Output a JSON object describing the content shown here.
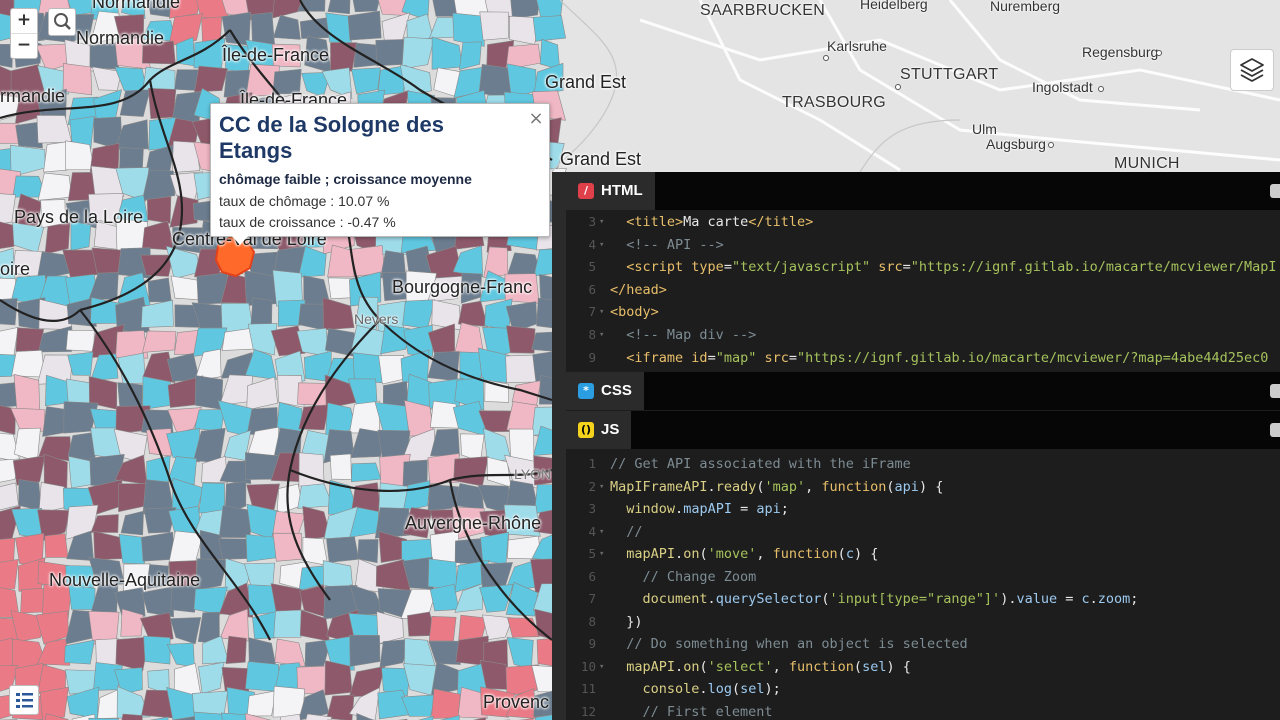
{
  "map": {
    "zoom_in": "+",
    "zoom_out": "−",
    "regions": [
      {
        "name": "Normandie",
        "id": "normandie-top"
      },
      {
        "name": "Normandie",
        "id": "normandie"
      },
      {
        "name": "rmandie",
        "id": "normandie-left"
      },
      {
        "name": "Île-de-France",
        "id": "idf"
      },
      {
        "name": "Île-de-France",
        "id": "idf2"
      },
      {
        "name": "Grand Est",
        "id": "grandest"
      },
      {
        "name": "Grand Est",
        "id": "grandest2"
      },
      {
        "name": "Pays de la Loire",
        "id": "pdl"
      },
      {
        "name": "oire",
        "id": "loire-left"
      },
      {
        "name": "Centre-Val de Loire",
        "id": "cvl"
      },
      {
        "name": "Bourgogne-Franc",
        "id": "bfc"
      },
      {
        "name": "Auvergne-Rhône",
        "id": "ara"
      },
      {
        "name": "Nouvelle-Aquitaine",
        "id": "na"
      },
      {
        "name": "Provenc",
        "id": "paca"
      }
    ],
    "cities": {
      "saarbrucken": "SAARBRUCKEN",
      "heidelberg": "Heidelberg",
      "nuremberg": "Nuremberg",
      "karlsruhe": "Karlsruhe",
      "regensburg": "Regensburg",
      "stuttgart": "STUTTGART",
      "ingolstadt": "Ingolstadt",
      "strasbourg": "TRASBOURG",
      "ulm": "Ulm",
      "augsburg": "Augsburg",
      "munich": "MUNICH",
      "nevers": "Nevers",
      "lyon": "LYON"
    },
    "colors": {
      "cyan": "#5fc8e0",
      "lightcyan": "#9fdcea",
      "slate": "#6b7d8f",
      "mauve": "#8e5a6b",
      "pink": "#f0b7c4",
      "red": "#ea7a86",
      "border": "#222"
    }
  },
  "popup": {
    "title": "CC de la Sologne des Etangs",
    "subtitle": "chômage faible ; croissance moyenne",
    "line1": "taux de chômage : 10.07 %",
    "line2": "taux de croissance : -0.47 %",
    "close": "×"
  },
  "editor": {
    "html_tab": "HTML",
    "css_tab": "CSS",
    "js_tab": "JS",
    "html_lines": [
      {
        "n": "3",
        "fold": "▾",
        "segs": [
          [
            "c-pl",
            "  "
          ],
          [
            "c-tag",
            "<title>"
          ],
          [
            "c-pl",
            "Ma carte"
          ],
          [
            "c-tag",
            "</title>"
          ]
        ]
      },
      {
        "n": "4",
        "fold": "▾",
        "segs": [
          [
            "c-pl",
            "  "
          ],
          [
            "c-cm",
            "<!-- API -->"
          ]
        ]
      },
      {
        "n": "5",
        "fold": "",
        "segs": [
          [
            "c-pl",
            "  "
          ],
          [
            "c-tag",
            "<script "
          ],
          [
            "c-attr",
            "type"
          ],
          [
            "c-pl",
            "="
          ],
          [
            "c-str",
            "\"text/javascript\""
          ],
          [
            "c-pl",
            " "
          ],
          [
            "c-attr",
            "src"
          ],
          [
            "c-pl",
            "="
          ],
          [
            "c-str",
            "\"https://ignf.gitlab.io/macarte/mcviewer/MapI"
          ]
        ]
      },
      {
        "n": "6",
        "fold": "",
        "segs": [
          [
            "c-tag",
            "</head>"
          ]
        ]
      },
      {
        "n": "7",
        "fold": "▾",
        "segs": [
          [
            "c-tag",
            "<body>"
          ]
        ]
      },
      {
        "n": "8",
        "fold": "▾",
        "segs": [
          [
            "c-pl",
            "  "
          ],
          [
            "c-cm",
            "<!-- Map div -->"
          ]
        ]
      },
      {
        "n": "9",
        "fold": "",
        "segs": [
          [
            "c-pl",
            "  "
          ],
          [
            "c-tag",
            "<iframe "
          ],
          [
            "c-attr",
            "id"
          ],
          [
            "c-pl",
            "="
          ],
          [
            "c-str",
            "\"map\""
          ],
          [
            "c-pl",
            " "
          ],
          [
            "c-attr",
            "src"
          ],
          [
            "c-pl",
            "="
          ],
          [
            "c-str",
            "\"https://ignf.gitlab.io/macarte/mcviewer/?map=4abe44d25ec0"
          ]
        ]
      }
    ],
    "js_lines": [
      {
        "n": "1",
        "fold": "",
        "segs": [
          [
            "c-cm",
            "// Get API associated with the iFrame"
          ]
        ]
      },
      {
        "n": "2",
        "fold": "▾",
        "segs": [
          [
            "c-fn",
            "MapIFrameAPI"
          ],
          [
            "c-pl",
            "."
          ],
          [
            "c-fn",
            "ready"
          ],
          [
            "c-pl",
            "("
          ],
          [
            "c-str",
            "'map'"
          ],
          [
            "c-pl",
            ", "
          ],
          [
            "c-kw",
            "function"
          ],
          [
            "c-pl",
            "("
          ],
          [
            "c-var",
            "api"
          ],
          [
            "c-pl",
            ") {"
          ]
        ]
      },
      {
        "n": "3",
        "fold": "",
        "segs": [
          [
            "c-pl",
            "  "
          ],
          [
            "c-fn",
            "window"
          ],
          [
            "c-pl",
            "."
          ],
          [
            "c-var",
            "mapAPI"
          ],
          [
            "c-pl",
            " = "
          ],
          [
            "c-var",
            "api"
          ],
          [
            "c-pl",
            ";"
          ]
        ]
      },
      {
        "n": "4",
        "fold": "▾",
        "segs": [
          [
            "c-pl",
            "  "
          ],
          [
            "c-cm",
            "//"
          ]
        ]
      },
      {
        "n": "5",
        "fold": "▾",
        "segs": [
          [
            "c-pl",
            "  "
          ],
          [
            "c-fn",
            "mapAPI"
          ],
          [
            "c-pl",
            "."
          ],
          [
            "c-fn",
            "on"
          ],
          [
            "c-pl",
            "("
          ],
          [
            "c-str",
            "'move'"
          ],
          [
            "c-pl",
            ", "
          ],
          [
            "c-kw",
            "function"
          ],
          [
            "c-pl",
            "("
          ],
          [
            "c-var",
            "c"
          ],
          [
            "c-pl",
            ") {"
          ]
        ]
      },
      {
        "n": "6",
        "fold": "",
        "segs": [
          [
            "c-pl",
            "    "
          ],
          [
            "c-cm",
            "// Change Zoom"
          ]
        ]
      },
      {
        "n": "7",
        "fold": "",
        "segs": [
          [
            "c-pl",
            "    "
          ],
          [
            "c-fn",
            "document"
          ],
          [
            "c-pl",
            "."
          ],
          [
            "c-var",
            "querySelector"
          ],
          [
            "c-pl",
            "("
          ],
          [
            "c-str",
            "'input[type=\"range\"]'"
          ],
          [
            "c-pl",
            ")."
          ],
          [
            "c-var",
            "value"
          ],
          [
            "c-pl",
            " = "
          ],
          [
            "c-var",
            "c"
          ],
          [
            "c-pl",
            "."
          ],
          [
            "c-var",
            "zoom"
          ],
          [
            "c-pl",
            ";"
          ]
        ]
      },
      {
        "n": "8",
        "fold": "",
        "segs": [
          [
            "c-pl",
            "  })"
          ]
        ]
      },
      {
        "n": "9",
        "fold": "",
        "segs": [
          [
            "c-pl",
            "  "
          ],
          [
            "c-cm",
            "// Do something when an object is selected"
          ]
        ]
      },
      {
        "n": "10",
        "fold": "▾",
        "segs": [
          [
            "c-pl",
            "  "
          ],
          [
            "c-fn",
            "mapAPI"
          ],
          [
            "c-pl",
            "."
          ],
          [
            "c-fn",
            "on"
          ],
          [
            "c-pl",
            "("
          ],
          [
            "c-str",
            "'select'"
          ],
          [
            "c-pl",
            ", "
          ],
          [
            "c-kw",
            "function"
          ],
          [
            "c-pl",
            "("
          ],
          [
            "c-var",
            "sel"
          ],
          [
            "c-pl",
            ") {"
          ]
        ]
      },
      {
        "n": "11",
        "fold": "",
        "segs": [
          [
            "c-pl",
            "    "
          ],
          [
            "c-fn",
            "console"
          ],
          [
            "c-pl",
            "."
          ],
          [
            "c-var",
            "log"
          ],
          [
            "c-pl",
            "("
          ],
          [
            "c-var",
            "sel"
          ],
          [
            "c-pl",
            ");"
          ]
        ]
      },
      {
        "n": "12",
        "fold": "",
        "segs": [
          [
            "c-pl",
            "    "
          ],
          [
            "c-cm",
            "// First element"
          ]
        ]
      }
    ]
  }
}
